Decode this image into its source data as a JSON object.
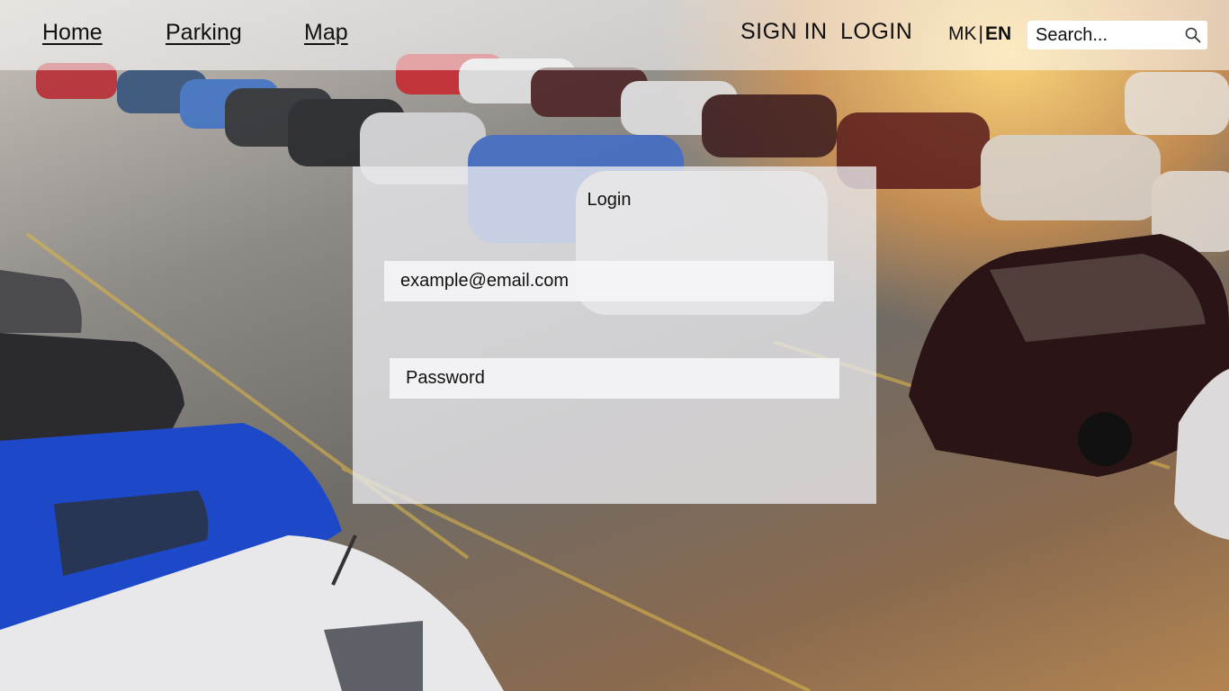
{
  "nav": {
    "home": "Home",
    "parking": "Parking",
    "map": "Map"
  },
  "auth": {
    "sign_in": "SIGN IN",
    "login": "LOGIN"
  },
  "language": {
    "mk": "MK",
    "separator": "|",
    "en": "EN",
    "active": "EN"
  },
  "search": {
    "placeholder": "Search...",
    "icon": "search-icon"
  },
  "login_form": {
    "title": "Login",
    "email_placeholder": "example@email.com",
    "password_placeholder": "Password"
  }
}
